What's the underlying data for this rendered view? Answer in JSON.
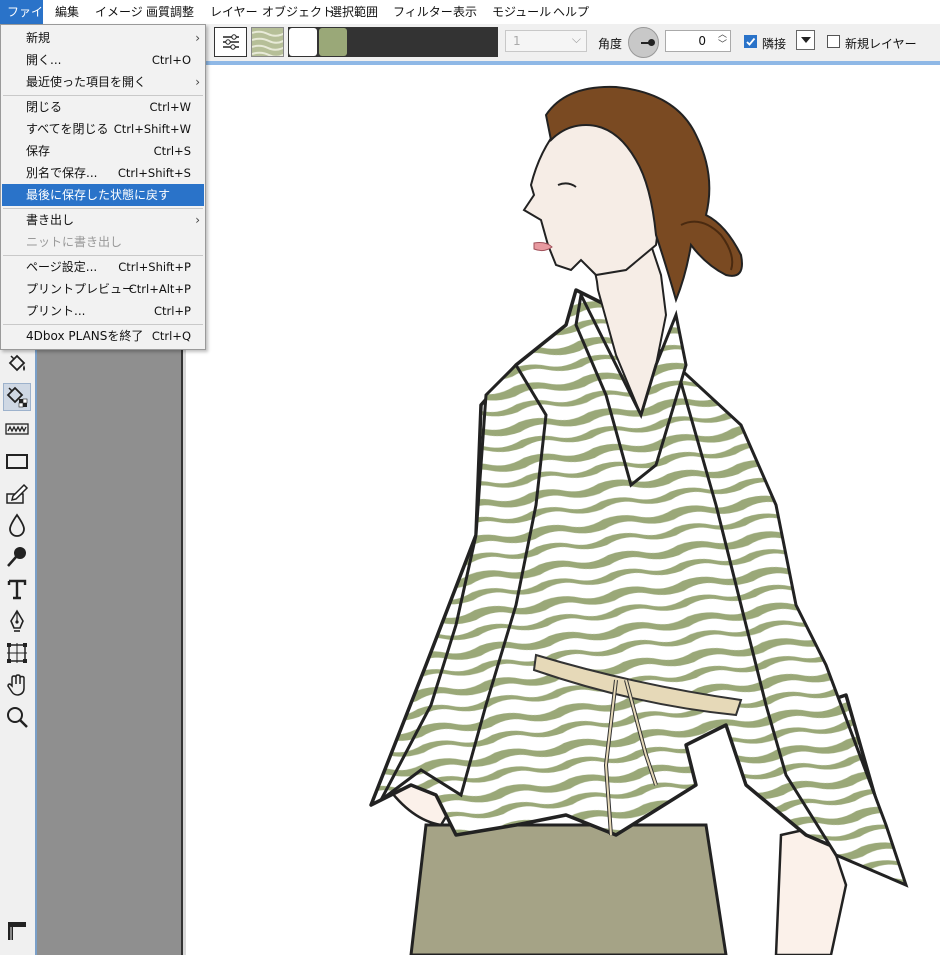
{
  "menubar": {
    "items": [
      "ファイル",
      "編集",
      "イメージ",
      "画質調整",
      "レイヤー",
      "オブジェクト",
      "選択範囲",
      "フィルター",
      "表示",
      "モジュール",
      "ヘルプ"
    ]
  },
  "optionbar": {
    "size_value": "1",
    "angle_label": "角度",
    "angle_value": "0",
    "adjacent_label": "隣接",
    "adjacent_checked": true,
    "new_layer_label": "新規レイヤー",
    "new_layer_checked": false,
    "fg_color": "#ffffff",
    "bg_color": "#9aa878"
  },
  "file_menu": {
    "items": [
      {
        "label": "新規",
        "shortcut": "",
        "submenu": true
      },
      {
        "label": "開く...",
        "shortcut": "Ctrl+O"
      },
      {
        "label": "最近使った項目を開く",
        "shortcut": "",
        "submenu": true
      },
      {
        "label": "閉じる",
        "shortcut": "Ctrl+W"
      },
      {
        "label": "すべてを閉じる",
        "shortcut": "Ctrl+Shift+W"
      },
      {
        "label": "保存",
        "shortcut": "Ctrl+S"
      },
      {
        "label": "別名で保存...",
        "shortcut": "Ctrl+Shift+S"
      },
      {
        "label": "最後に保存した状態に戻す",
        "shortcut": "",
        "highlighted": true
      },
      {
        "label": "書き出し",
        "shortcut": "",
        "submenu": true
      },
      {
        "label": "ニットに書き出し",
        "shortcut": "",
        "disabled": true
      },
      {
        "label": "ページ設定...",
        "shortcut": "Ctrl+Shift+P"
      },
      {
        "label": "プリントプレビュー",
        "shortcut": "Ctrl+Alt+P"
      },
      {
        "label": "プリント...",
        "shortcut": "Ctrl+P"
      },
      {
        "label": "4Dbox PLANSを終了",
        "shortcut": "Ctrl+Q"
      }
    ]
  },
  "toolbar": {
    "tools": [
      "bucket-fill-icon",
      "pattern-fill-icon",
      "wave-icon",
      "rectangle-icon",
      "edit-pen-icon",
      "drop-icon",
      "smudge-icon",
      "text-icon",
      "pen-nib-icon",
      "transform-icon",
      "hand-icon",
      "zoom-icon",
      "ruler-icon"
    ]
  },
  "colors": {
    "accent": "#2a73c9",
    "stripe_green": "#9aa878",
    "hair": "#7a4a22",
    "skirt": "#a5a386"
  }
}
